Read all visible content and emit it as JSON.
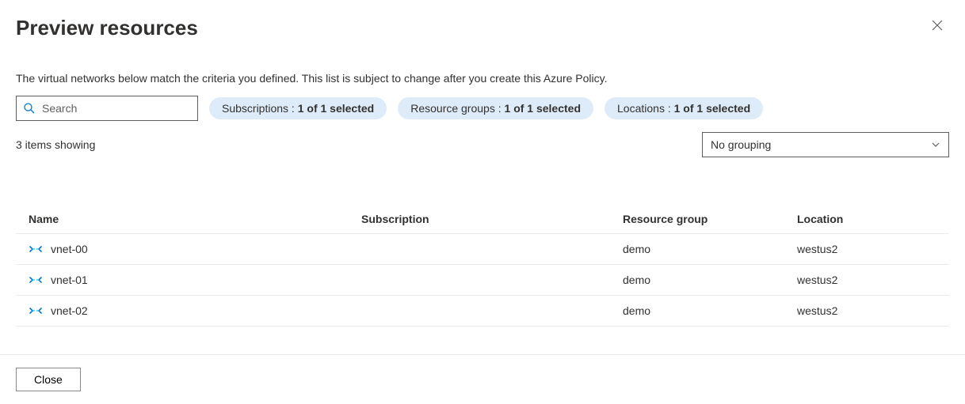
{
  "header": {
    "title": "Preview resources"
  },
  "description": "The virtual networks below match the criteria you defined. This list is subject to change after you create this Azure Policy.",
  "search": {
    "placeholder": "Search",
    "value": ""
  },
  "filters": {
    "subscriptions": {
      "prefix": "Subscriptions : ",
      "value": "1 of 1 selected"
    },
    "resource_groups": {
      "prefix": "Resource groups : ",
      "value": "1 of 1 selected"
    },
    "locations": {
      "prefix": "Locations : ",
      "value": "1 of 1 selected"
    }
  },
  "count_text": "3 items showing",
  "grouping": {
    "selected": "No grouping"
  },
  "columns": {
    "name": "Name",
    "subscription": "Subscription",
    "resource_group": "Resource group",
    "location": "Location"
  },
  "rows": [
    {
      "name": "vnet-00",
      "subscription": "",
      "resource_group": "demo",
      "location": "westus2"
    },
    {
      "name": "vnet-01",
      "subscription": "",
      "resource_group": "demo",
      "location": "westus2"
    },
    {
      "name": "vnet-02",
      "subscription": "",
      "resource_group": "demo",
      "location": "westus2"
    }
  ],
  "footer": {
    "close_label": "Close"
  }
}
